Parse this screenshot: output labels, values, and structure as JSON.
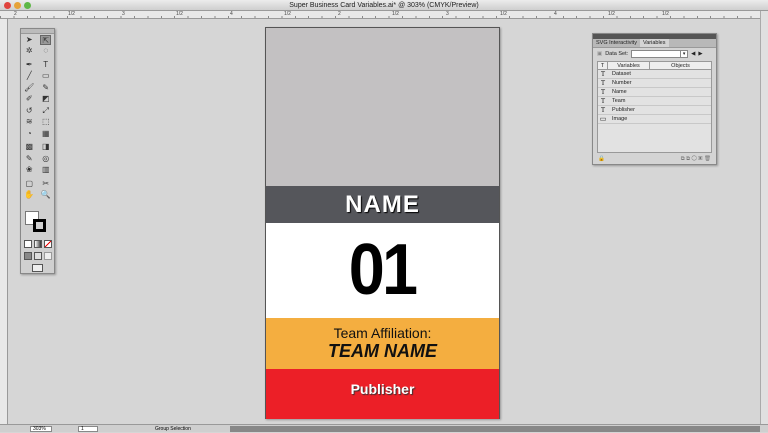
{
  "window": {
    "title": "Super Business Card Variables.ai* @ 303% (CMYK/Preview)"
  },
  "ruler": {
    "labels": [
      "2",
      "1/2",
      "3",
      "1/2",
      "4",
      "1/2",
      "2",
      "1/2",
      "3",
      "1/2",
      "4",
      "1/2",
      "1/2"
    ]
  },
  "tools": [
    [
      "selection-tool",
      "direct-selection-tool"
    ],
    [
      "magic-wand-tool",
      "lasso-tool"
    ],
    [
      "pen-tool",
      "type-tool"
    ],
    [
      "line-tool",
      "rectangle-tool"
    ],
    [
      "paintbrush-tool",
      "pencil-tool"
    ],
    [
      "blob-brush-tool",
      "eraser-tool"
    ],
    [
      "rotate-tool",
      "scale-tool"
    ],
    [
      "warp-tool",
      "free-transform-tool"
    ],
    [
      "shape-builder-tool",
      "perspective-grid-tool"
    ],
    [
      "mesh-tool",
      "gradient-tool"
    ],
    [
      "eyedropper-tool",
      "blend-tool"
    ],
    [
      "symbol-sprayer-tool",
      "column-graph-tool"
    ],
    [
      "artboard-tool",
      "slice-tool"
    ],
    [
      "hand-tool",
      "zoom-tool"
    ]
  ],
  "tool_glyphs": [
    [
      "➤",
      "⇱"
    ],
    [
      "✲",
      "◌"
    ],
    [
      "✒",
      "T"
    ],
    [
      "╱",
      "▭"
    ],
    [
      "🖌",
      "✎"
    ],
    [
      "✐",
      "◩"
    ],
    [
      "↺",
      "⤢"
    ],
    [
      "≋",
      "⬚"
    ],
    [
      "◔",
      "▦"
    ],
    [
      "▩",
      "◨"
    ],
    [
      "✎",
      "◎"
    ],
    [
      "❀",
      "▥"
    ],
    [
      "▢",
      "✂"
    ],
    [
      "✋",
      "🔍"
    ]
  ],
  "card": {
    "name": "NAME",
    "number": "01",
    "team_label": "Team Affiliation:",
    "team_name": "TEAM NAME",
    "publisher": "Publisher",
    "colors": {
      "photo": "#c3c1c2",
      "name_band": "#55565b",
      "team_band": "#f4ae40",
      "publisher_band": "#ec1f27"
    }
  },
  "panel": {
    "tabs": [
      "SVG Interactivity",
      "Variables"
    ],
    "dataset_label": "Data Set:",
    "dataset_value": "",
    "columns": [
      "Variables",
      "Objects"
    ],
    "variables": [
      {
        "type": "text",
        "icon": "T",
        "name": "Dataset"
      },
      {
        "type": "text",
        "icon": "T",
        "name": "Number"
      },
      {
        "type": "text",
        "icon": "T",
        "name": "Name"
      },
      {
        "type": "text",
        "icon": "T",
        "name": "Team"
      },
      {
        "type": "text",
        "icon": "T",
        "name": "Publisher"
      },
      {
        "type": "image",
        "icon": "▭",
        "name": "Image"
      }
    ]
  },
  "status": {
    "zoom": "303%",
    "page": "1",
    "mode": "Group Selection"
  }
}
